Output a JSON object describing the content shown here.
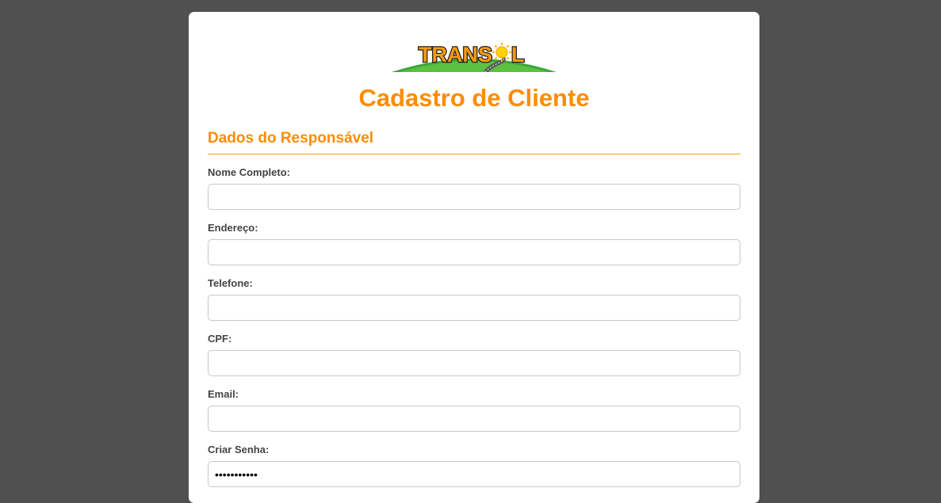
{
  "brand": {
    "logo_text_left": "TRANS",
    "logo_text_right": "L"
  },
  "page": {
    "title": "Cadastro de Cliente"
  },
  "section": {
    "title": "Dados do Responsável"
  },
  "fields": [
    {
      "label": "Nome Completo:",
      "value": ""
    },
    {
      "label": "Endereço:",
      "value": ""
    },
    {
      "label": "Telefone:",
      "value": ""
    },
    {
      "label": "CPF:",
      "value": ""
    },
    {
      "label": "Email:",
      "value": ""
    },
    {
      "label": "Criar Senha:",
      "value": "•••••••••••"
    }
  ],
  "colors": {
    "accent": "#ff8c00",
    "background": "#505050",
    "card": "#ffffff",
    "label": "#444444"
  }
}
